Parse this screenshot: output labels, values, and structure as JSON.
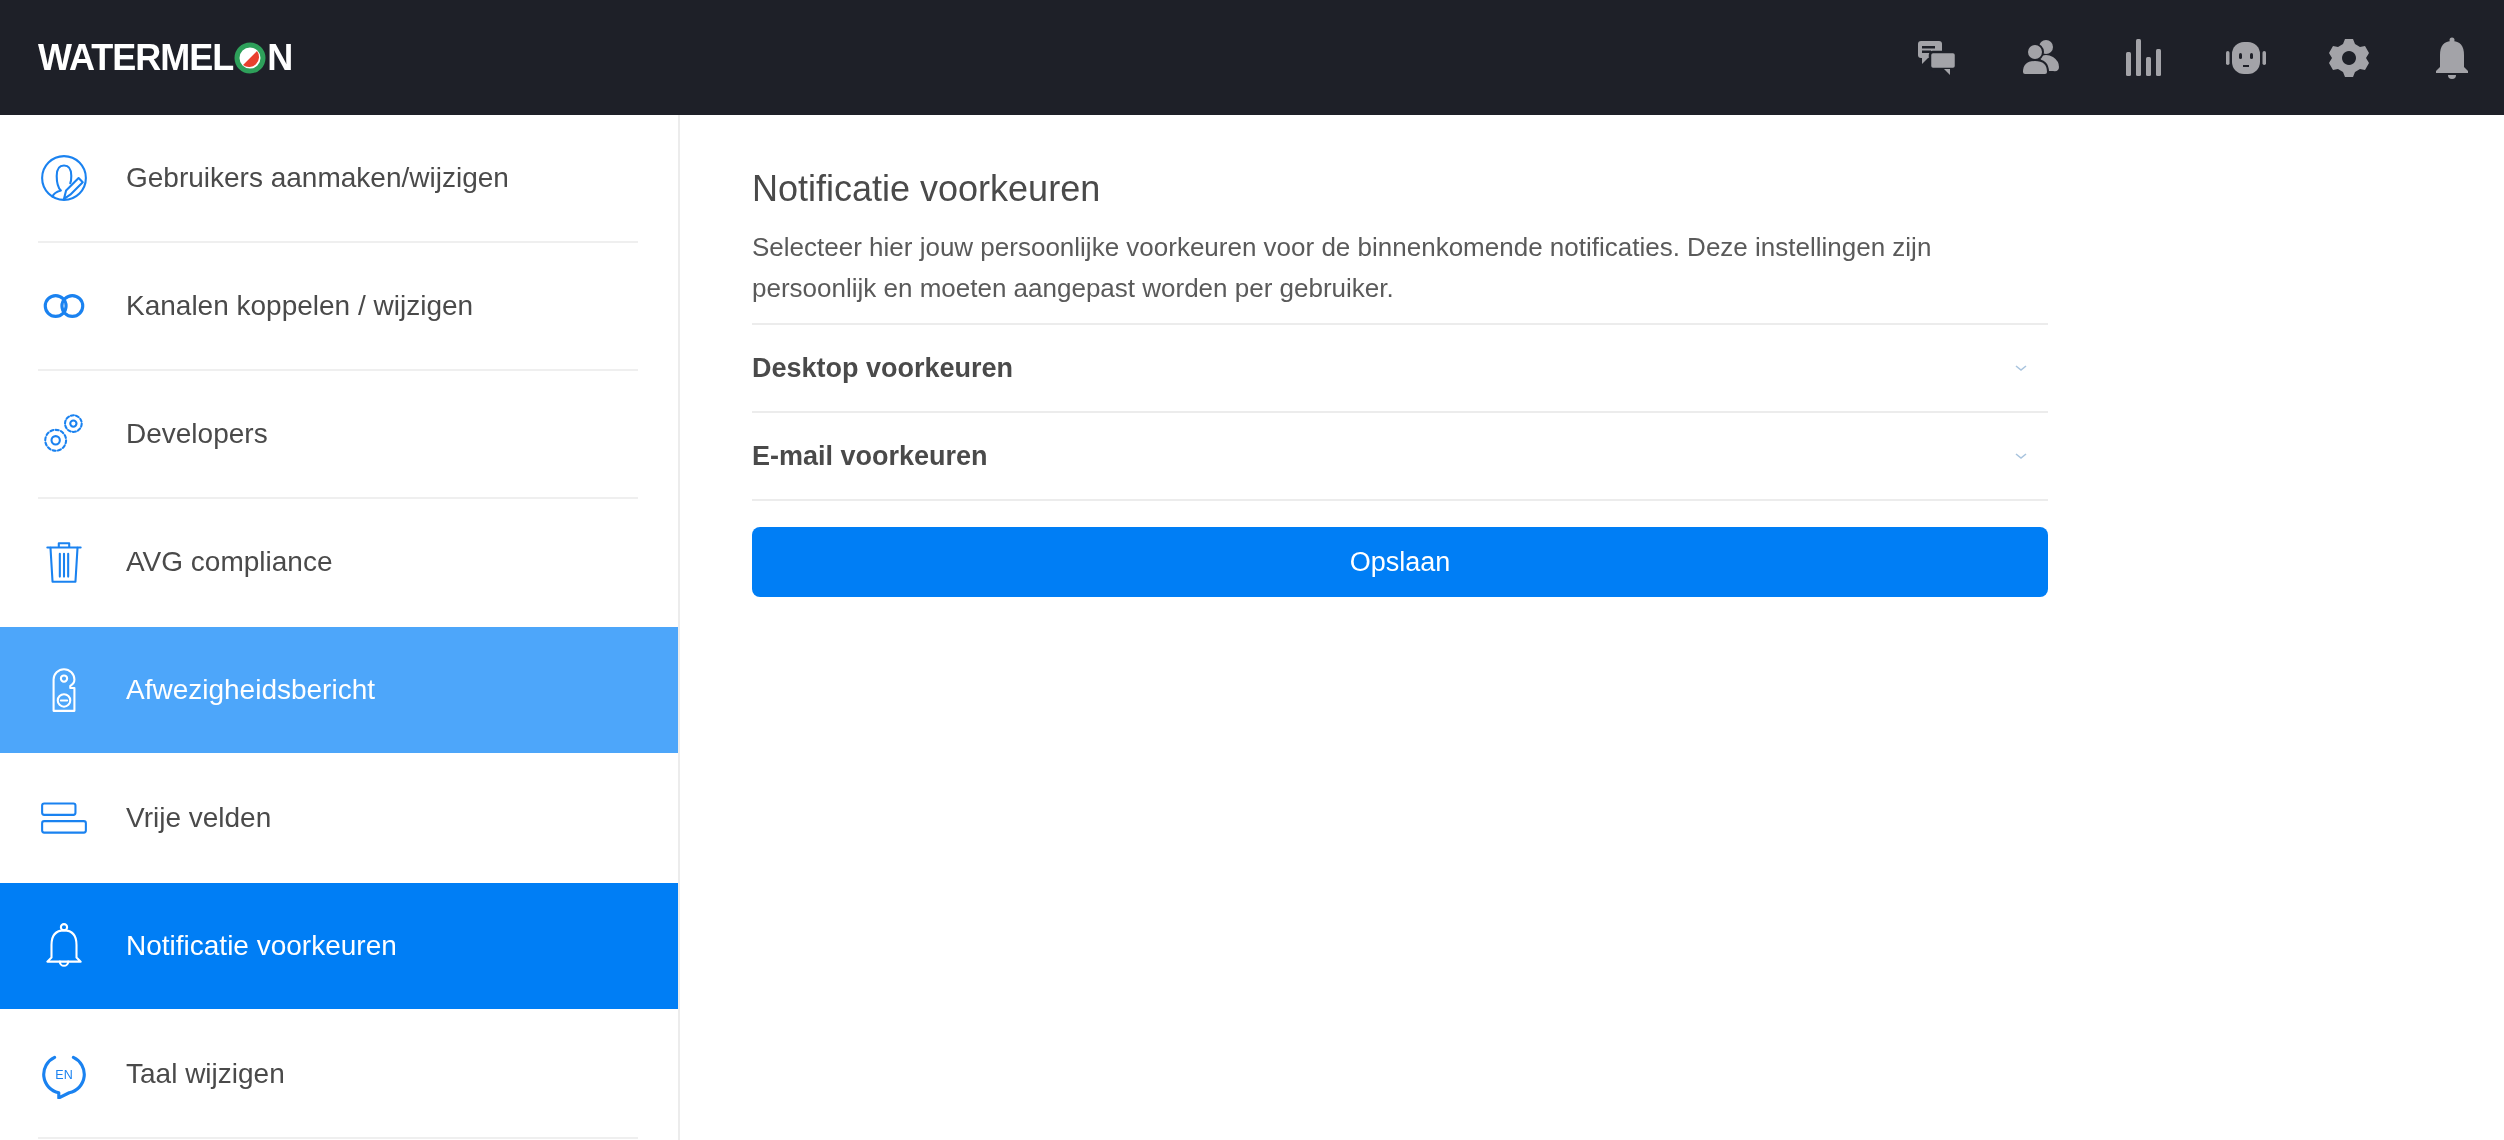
{
  "header": {
    "logo": {
      "text_start": "WATERMEL",
      "text_end": "N"
    },
    "icons": [
      {
        "kind": "chat"
      },
      {
        "kind": "contacts"
      },
      {
        "kind": "stats"
      },
      {
        "kind": "bot"
      },
      {
        "kind": "settings"
      },
      {
        "kind": "bell"
      }
    ]
  },
  "sidebar": {
    "items": [
      {
        "label": "Gebruikers aanmaken/wijzigen",
        "kind": "user-edit",
        "selected": false,
        "hovered": false
      },
      {
        "label": "Kanalen koppelen / wijzigen",
        "kind": "link",
        "selected": false,
        "hovered": false
      },
      {
        "label": "Developers",
        "kind": "gears",
        "selected": false,
        "hovered": false
      },
      {
        "label": "AVG compliance",
        "kind": "trash",
        "selected": false,
        "hovered": false
      },
      {
        "label": "Afwezigheidsbericht",
        "kind": "door-hanger",
        "selected": false,
        "hovered": true
      },
      {
        "label": "Vrije velden",
        "kind": "fields",
        "selected": false,
        "hovered": false
      },
      {
        "label": "Notificatie voorkeuren",
        "kind": "bell",
        "selected": true,
        "hovered": false
      },
      {
        "label": "Taal wijzigen",
        "kind": "language",
        "icon_text": "EN",
        "selected": false,
        "hovered": false
      }
    ]
  },
  "main": {
    "title": "Notificatie voorkeuren",
    "description": "Selecteer hier jouw persoonlijke voorkeuren voor de binnenkomende notificaties. Deze instellingen zijn persoonlijk en moeten aangepast worden per gebruiker.",
    "sections": [
      {
        "label": "Desktop voorkeuren",
        "expanded": false
      },
      {
        "label": "E-mail voorkeuren",
        "expanded": false
      }
    ],
    "save_button": "Opslaan"
  }
}
